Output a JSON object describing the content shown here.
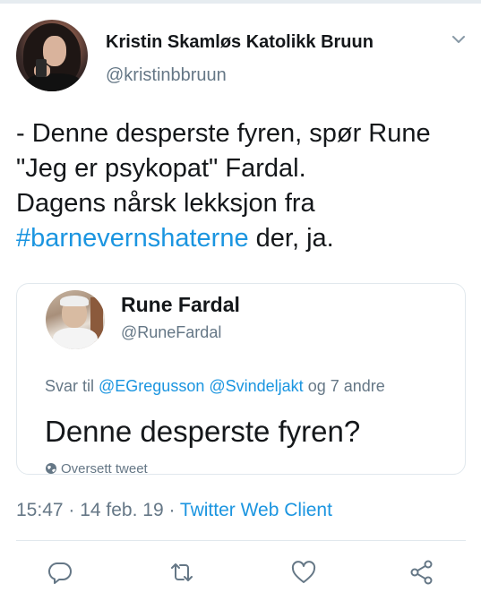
{
  "tweet": {
    "author": {
      "name": "Kristin Skamløs Katolikk Bruun",
      "handle": "@kristinbbruun"
    },
    "text_lines": [
      "- Denne desperste fyren, spør Rune",
      "\"Jeg er psykopat\" Fardal.",
      "Dagens nårsk lekksjon fra"
    ],
    "hashtag": "#barnevernshaterne",
    "text_tail": " der, ja."
  },
  "quoted": {
    "name": "Rune Fardal",
    "handle": "@RuneFardal",
    "reply_prefix": "Svar til ",
    "mention1": "@EGregusson",
    "mention2": "@Svindeljakt",
    "reply_suffix": " og 7 andre",
    "text": "Denne desperste fyren?",
    "translate": "Oversett tweet"
  },
  "meta": {
    "time_date": "15:47 · 14 feb. 19 · ",
    "client": "Twitter Web Client"
  },
  "icons": {
    "reply": "reply-icon",
    "retweet": "retweet-icon",
    "like": "like-icon",
    "share": "share-icon",
    "chevron": "chevron-down-icon",
    "globe": "globe-icon"
  },
  "colors": {
    "link": "#1b95e0",
    "secondary": "#657786",
    "text": "#14171a",
    "border": "#e1e8ed"
  }
}
